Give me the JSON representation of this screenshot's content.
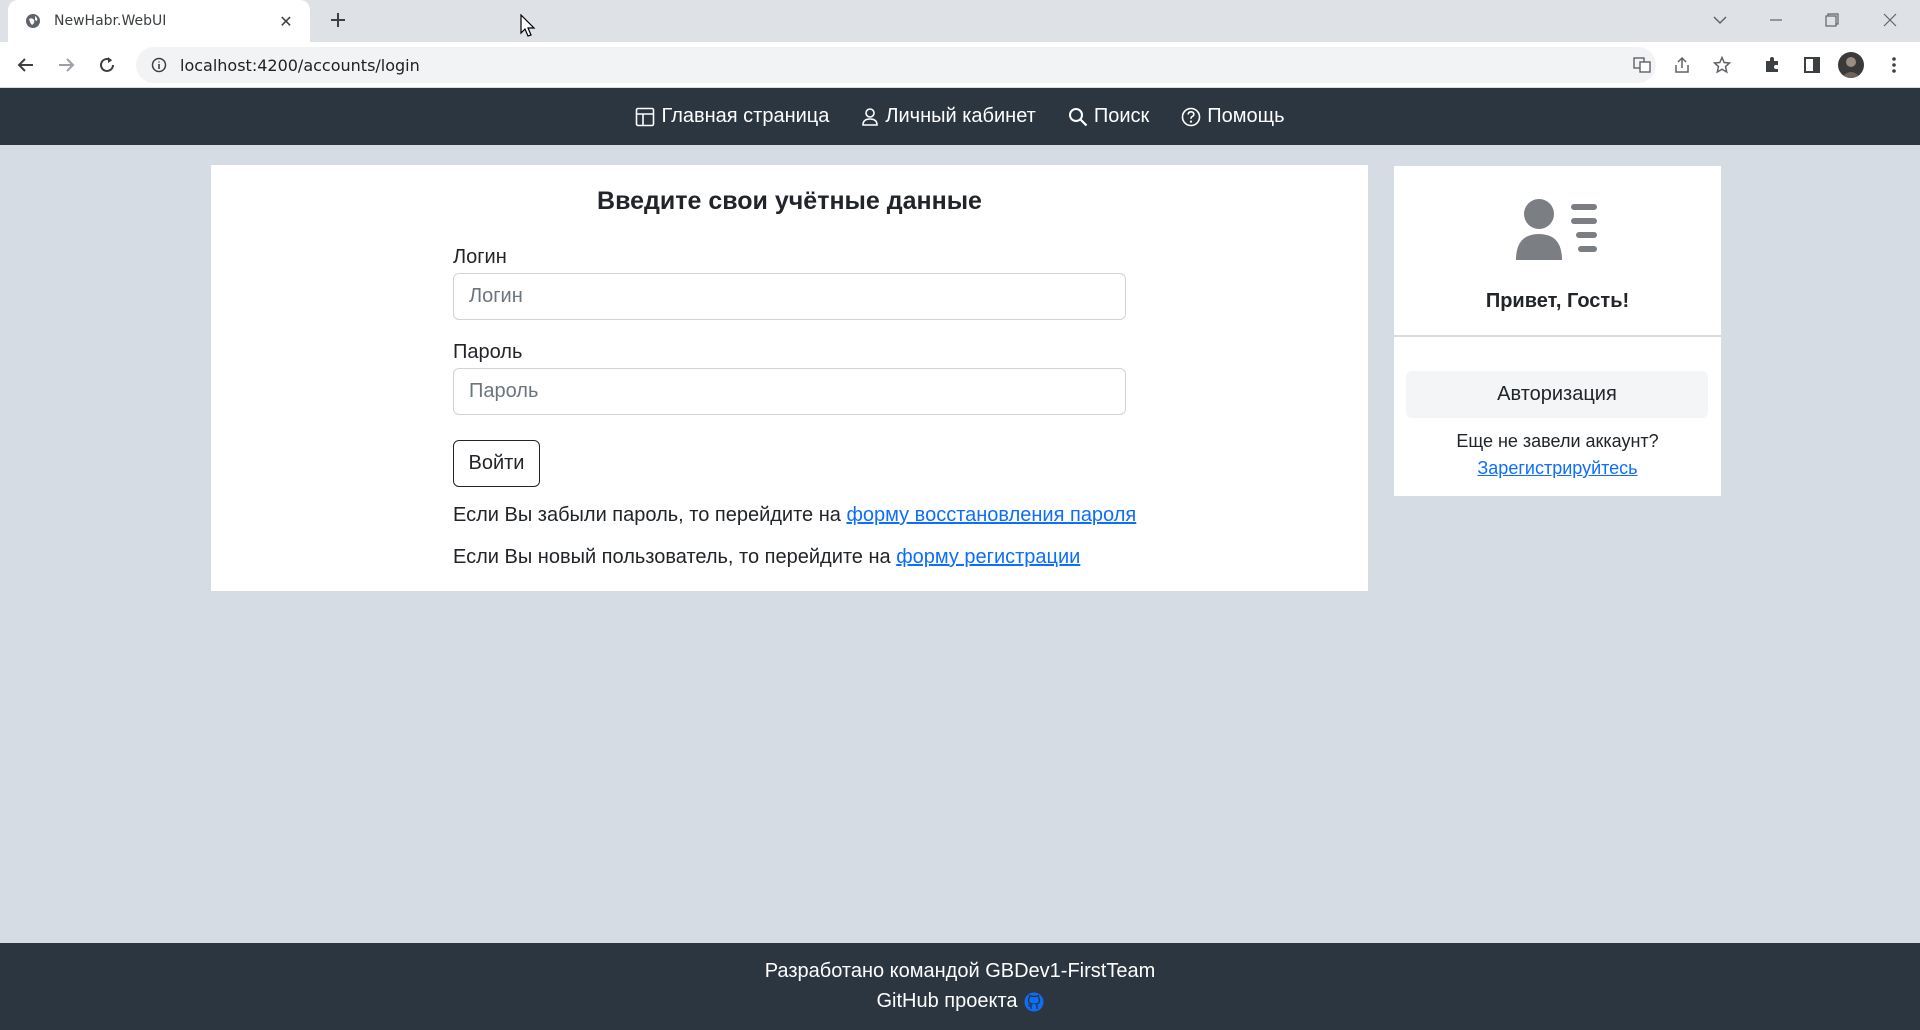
{
  "browser": {
    "tab_title": "NewHabr.WebUI",
    "url": "localhost:4200/accounts/login"
  },
  "navbar": {
    "items": [
      {
        "label": "Главная страница",
        "icon": "layout-icon"
      },
      {
        "label": "Личный кабинет",
        "icon": "person-icon"
      },
      {
        "label": "Поиск",
        "icon": "search-icon"
      },
      {
        "label": "Помощь",
        "icon": "question-circle-icon"
      }
    ]
  },
  "login": {
    "title": "Введите свои учётные данные",
    "login_label": "Логин",
    "login_placeholder": "Логин",
    "password_label": "Пароль",
    "password_placeholder": "Пароль",
    "submit_label": "Войти",
    "forgot_text": "Если Вы забыли пароль, то перейдите на ",
    "forgot_link": "форму восстановления пароля",
    "register_text": "Если Вы новый пользователь, то перейдите на ",
    "register_link": "форму регистрации"
  },
  "sidebar": {
    "greeting": "Привет, Гость!",
    "auth_button": "Авторизация",
    "no_account_text": "Еще не завели аккаунт?",
    "register_link": "Зарегистрируйтесь"
  },
  "footer": {
    "line1": "Разработано командой GBDev1-FirstTeam",
    "line2": "GitHub проекта"
  },
  "colors": {
    "navbar_bg": "#2b3640",
    "page_bg": "#d5dce4",
    "link": "#0d6efd"
  }
}
